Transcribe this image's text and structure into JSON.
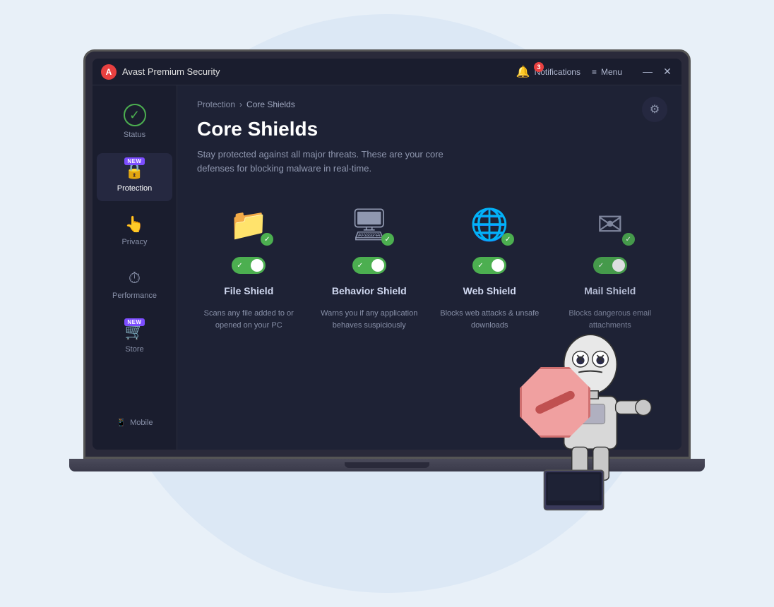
{
  "window": {
    "title": "Avast Premium Security",
    "logo": "A",
    "notification_count": "3",
    "notifications_label": "Notifications",
    "menu_label": "Menu"
  },
  "sidebar": {
    "items": [
      {
        "id": "status",
        "label": "Status",
        "icon": "check-circle",
        "active": false
      },
      {
        "id": "protection",
        "label": "Protection",
        "icon": "lock",
        "active": true,
        "badge": "NEW"
      },
      {
        "id": "privacy",
        "label": "Privacy",
        "icon": "fingerprint",
        "active": false
      },
      {
        "id": "performance",
        "label": "Performance",
        "icon": "speedometer",
        "active": false
      },
      {
        "id": "store",
        "label": "Store",
        "icon": "cart",
        "active": false,
        "badge": "NEW"
      }
    ],
    "mobile_label": "Mobile"
  },
  "breadcrumb": {
    "parent": "Protection",
    "separator": "›",
    "current": "Core Shields"
  },
  "content": {
    "title": "Core Shields",
    "description": "Stay protected against all major threats. These are your core defenses for blocking malware in real-time.",
    "shields": [
      {
        "id": "file-shield",
        "name": "File Shield",
        "description": "Scans any file added to or opened on your PC",
        "enabled": true,
        "icon": "folder"
      },
      {
        "id": "behavior-shield",
        "name": "Behavior Shield",
        "description": "Warns you if any application behaves suspiciously",
        "enabled": true,
        "icon": "monitor-card"
      },
      {
        "id": "web-shield",
        "name": "Web Shield",
        "description": "Blocks web attacks & unsafe downloads",
        "enabled": true,
        "icon": "globe"
      },
      {
        "id": "mail-shield",
        "name": "Mail Shield",
        "description": "Blocks dangerous email attachments",
        "enabled": true,
        "icon": "envelope"
      }
    ]
  },
  "colors": {
    "accent_green": "#4CAF50",
    "accent_purple": "#7c4dff",
    "accent_red": "#e84040",
    "bg_dark": "#1a1d2e",
    "bg_medium": "#1e2235",
    "text_light": "#ffffff",
    "text_muted": "#8890a8"
  }
}
